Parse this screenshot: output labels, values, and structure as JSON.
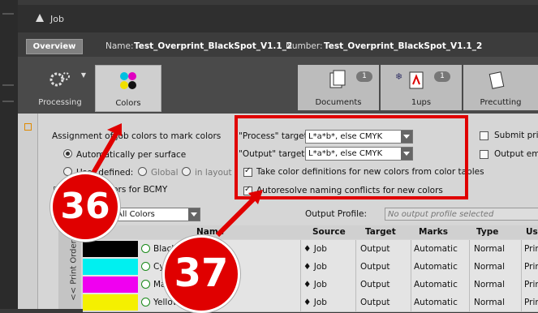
{
  "window": {
    "title": "Job"
  },
  "namebar": {
    "overview": "Overview",
    "name_label": "Name:",
    "name_value": "Test_Overprint_BlackSpot_V1.1_2",
    "number_label": "Number:",
    "number_value": "Test_Overprint_BlackSpot_V1.1_2"
  },
  "toolbar": {
    "processing": "Processing",
    "colors": "Colors",
    "steps": [
      {
        "label": "Documents",
        "badge": "1"
      },
      {
        "label": "1ups",
        "badge": "1"
      },
      {
        "label": "Precutting"
      }
    ]
  },
  "colors_panel": {
    "assignment_text": "Assignment of job colors to mark colors",
    "auto_label": "Automatically per surface",
    "user_label": "User defined:",
    "global_label": "Global",
    "in_layout_label": "in layout",
    "bcmy_label": "colors for BCMY",
    "process_target_label": "\"Process\" target",
    "process_target_value": "L*a*b*, else CMYK",
    "output_target_label": "\"Output\" target",
    "output_target_value": "L*a*b*, else CMYK",
    "take_color_defs": "Take color definitions for new colors from color tables",
    "autoresolve": "Autoresolve naming conflicts for new colors",
    "submit_label": "Submit prin",
    "output_emp_label": "Output emp",
    "filter_value": "All Colors",
    "output_profile_label": "Output Profile:",
    "output_profile_placeholder": "No output profile selected",
    "print_order_label": "<< Print Order <<"
  },
  "table": {
    "headers": {
      "name": "Name",
      "source": "Source",
      "target": "Target",
      "marks": "Marks",
      "type": "Type",
      "use": "Us"
    },
    "rows": [
      {
        "name": "Black",
        "source": "Job",
        "target": "Output",
        "marks": "Automatic",
        "type": "Normal",
        "use": "Print",
        "swatch": "#000000"
      },
      {
        "name": "Cyan",
        "source": "Job",
        "target": "Output",
        "marks": "Automatic",
        "type": "Normal",
        "use": "Print",
        "swatch": "#00f0f0"
      },
      {
        "name": "Magenta",
        "source": "Job",
        "target": "Output",
        "marks": "Automatic",
        "type": "Normal",
        "use": "Print",
        "swatch": "#f000f0"
      },
      {
        "name": "Yellow",
        "source": "Job",
        "target": "Output",
        "marks": "Automatic",
        "type": "Normal",
        "use": "Print",
        "swatch": "#f5f000"
      }
    ]
  },
  "annotations": {
    "callout_36": "36",
    "callout_37": "37",
    "color": "#e00000"
  }
}
